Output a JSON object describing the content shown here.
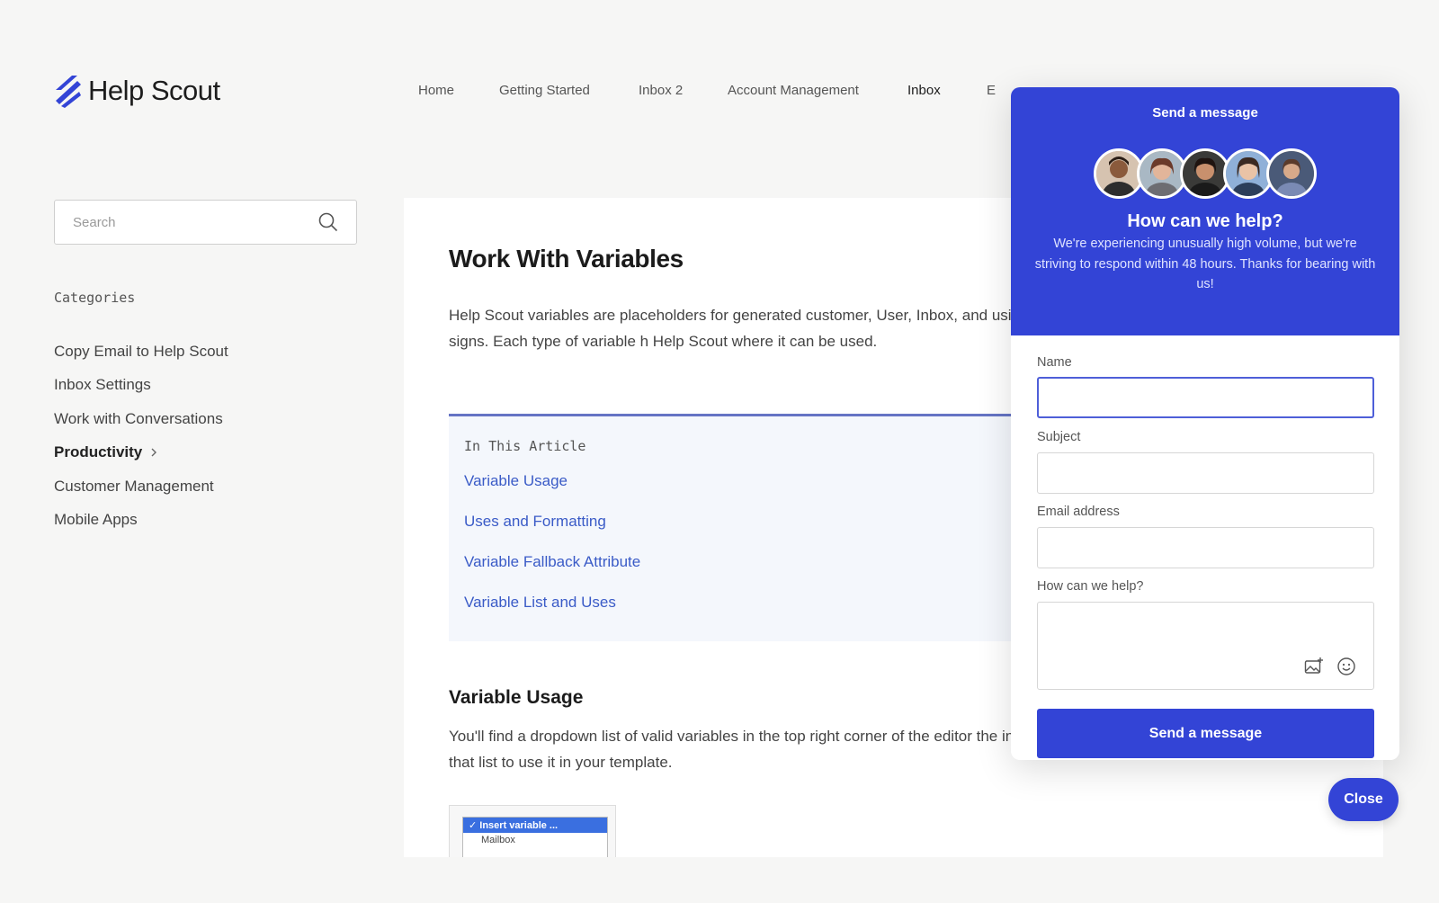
{
  "brand": {
    "name": "Help Scout",
    "accent": "#3344d6",
    "link": "#3a5bc7"
  },
  "nav": {
    "items": [
      {
        "label": "Home"
      },
      {
        "label": "Getting Started"
      },
      {
        "label": "Inbox 2"
      },
      {
        "label": "Account Management"
      },
      {
        "label": "Inbox"
      },
      {
        "label": "E"
      }
    ],
    "active": "Inbox"
  },
  "sidebar": {
    "search_placeholder": "Search",
    "categories_heading": "Categories",
    "categories": [
      {
        "label": "Copy Email to Help Scout"
      },
      {
        "label": "Inbox Settings"
      },
      {
        "label": "Work with Conversations"
      },
      {
        "label": "Productivity"
      },
      {
        "label": "Customer Management"
      },
      {
        "label": "Mobile Apps"
      }
    ]
  },
  "article": {
    "title": "Work With Variables",
    "intro": "Help Scout variables are placeholders for generated customer, User, Inbox, and using specific text between curly brackets and % signs. Each type of variable h Help Scout where it can be used.",
    "toc_heading": "In This Article",
    "toc": [
      {
        "label": "Variable Usage"
      },
      {
        "label": "Uses and Formatting"
      },
      {
        "label": "Variable Fallback Attribute"
      },
      {
        "label": "Variable List and Uses"
      }
    ],
    "section_title": "Variable Usage",
    "section_body": "You'll find a dropdown list of valid variables in the top right corner of the editor the inbox signature, or your auto reply. Pick one from that list to use it in your template.",
    "thumb": {
      "selected": "✓ Insert variable ...",
      "item": "Mailbox"
    }
  },
  "beacon": {
    "header_title": "Send a message",
    "question": "How can we help?",
    "message": "We're experiencing unusually high volume, but we're striving to respond within 48 hours. Thanks for bearing with us!",
    "avatar_count": 5,
    "fields": {
      "name_label": "Name",
      "name_value": "",
      "subject_label": "Subject",
      "email_label": "Email address",
      "help_label": "How can we help?"
    },
    "send_label": "Send a message",
    "close_label": "Close"
  }
}
